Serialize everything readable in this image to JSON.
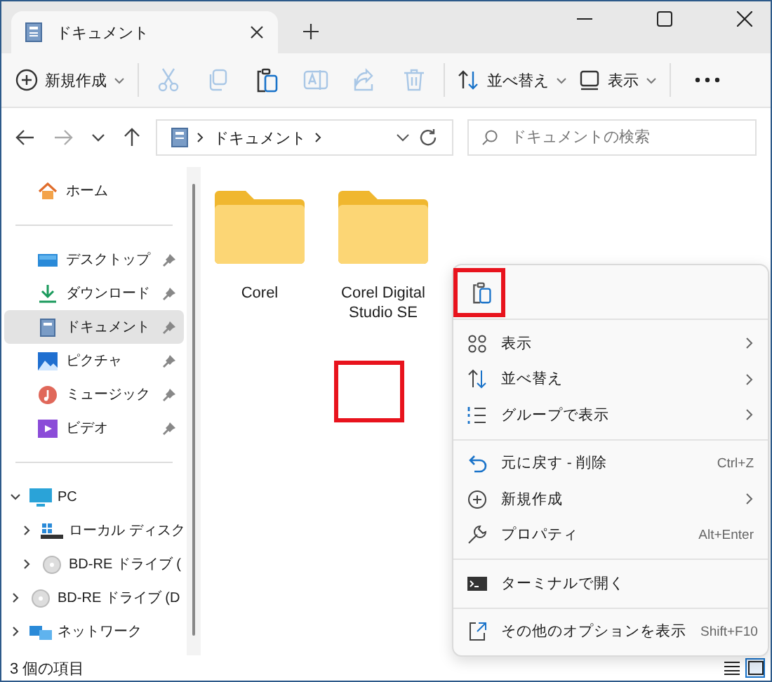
{
  "tab": {
    "title": "ドキュメント"
  },
  "toolbar": {
    "new_label": "新規作成",
    "actions": [
      {
        "kind": "cut",
        "disabled": true
      },
      {
        "kind": "copy",
        "disabled": true
      },
      {
        "kind": "paste",
        "disabled": false
      },
      {
        "kind": "rename",
        "disabled": true
      },
      {
        "kind": "share",
        "disabled": true
      },
      {
        "kind": "delete",
        "disabled": true
      }
    ],
    "sort_label": "並べ替え",
    "view_label": "表示"
  },
  "address": {
    "path": [
      "ドキュメント"
    ]
  },
  "search": {
    "placeholder": "ドキュメントの検索"
  },
  "sidebar": {
    "home": "ホーム",
    "quick_access": [
      {
        "kind": "desktop",
        "label": "デスクトップ",
        "pinned": true,
        "selected": false
      },
      {
        "kind": "download",
        "label": "ダウンロード",
        "pinned": true,
        "selected": false
      },
      {
        "kind": "documents",
        "label": "ドキュメント",
        "pinned": true,
        "selected": true
      },
      {
        "kind": "pictures",
        "label": "ピクチャ",
        "pinned": true,
        "selected": false
      },
      {
        "kind": "music",
        "label": "ミュージック",
        "pinned": true,
        "selected": false
      },
      {
        "kind": "video",
        "label": "ビデオ",
        "pinned": true,
        "selected": false
      }
    ],
    "tree": [
      {
        "kind": "pc",
        "label": "PC",
        "expanded": true,
        "children": [
          {
            "kind": "disk",
            "label": "ローカル ディスク",
            "expanded": false
          },
          {
            "kind": "disc",
            "label": "BD-RE ドライブ (",
            "expanded": false
          }
        ]
      },
      {
        "kind": "disc",
        "label": "BD-RE ドライブ (D",
        "expanded": false
      },
      {
        "kind": "network",
        "label": "ネットワーク",
        "expanded": false
      }
    ]
  },
  "files": [
    {
      "name": "Corel"
    },
    {
      "name": "Corel Digital Studio SE"
    }
  ],
  "context_menu": {
    "sections": [
      [
        {
          "kind": "view",
          "label": "表示",
          "submenu": true
        },
        {
          "kind": "sort",
          "label": "並べ替え",
          "submenu": true
        },
        {
          "kind": "group",
          "label": "グループで表示",
          "submenu": true
        }
      ],
      [
        {
          "kind": "undo",
          "label": "元に戻す - 削除",
          "shortcut": "Ctrl+Z",
          "submenu": false
        },
        {
          "kind": "new",
          "label": "新規作成",
          "submenu": true
        },
        {
          "kind": "properties",
          "label": "プロパティ",
          "shortcut": "Alt+Enter",
          "submenu": false
        }
      ],
      [
        {
          "kind": "terminal",
          "label": "ターミナルで開く",
          "submenu": false
        }
      ],
      [
        {
          "kind": "more",
          "label": "その他のオプションを表示",
          "shortcut": "Shift+F10",
          "submenu": false
        }
      ]
    ]
  },
  "highlights": {
    "menu_paste": true,
    "empty_area": true
  },
  "status_bar": {
    "count": "3 個の項目",
    "views": [
      {
        "kind": "details",
        "selected": false
      },
      {
        "kind": "tiles",
        "selected": true
      }
    ]
  }
}
